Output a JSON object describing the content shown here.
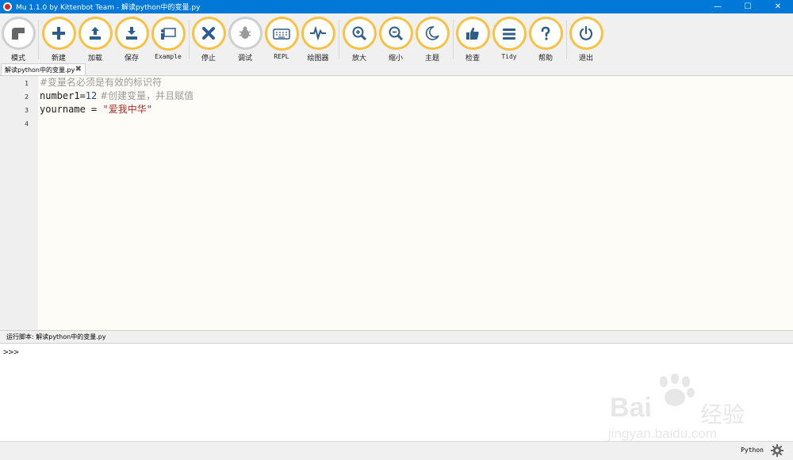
{
  "window": {
    "title": "Mu 1.1.0 by Kittenbot Team - 解读python中的变量.py",
    "minimize_glyph": "—",
    "maximize_glyph": "☐",
    "close_glyph": "✕"
  },
  "toolbar": {
    "accent_color": "#f7c244",
    "buttons": [
      {
        "label": "模式",
        "icon": "mode-icon"
      },
      {
        "label": "新建",
        "icon": "plus-icon"
      },
      {
        "label": "加载",
        "icon": "upload-icon"
      },
      {
        "label": "保存",
        "icon": "download-icon"
      },
      {
        "label": "Example",
        "icon": "presentation-icon"
      },
      {
        "label": "停止",
        "icon": "close-icon"
      },
      {
        "label": "调试",
        "icon": "bug-icon"
      },
      {
        "label": "REPL",
        "icon": "keyboard-icon"
      },
      {
        "label": "绘图器",
        "icon": "pulse-icon"
      },
      {
        "label": "放大",
        "icon": "zoom-in-icon"
      },
      {
        "label": "缩小",
        "icon": "zoom-out-icon"
      },
      {
        "label": "主题",
        "icon": "moon-icon"
      },
      {
        "label": "检查",
        "icon": "thumbs-up-icon"
      },
      {
        "label": "Tidy",
        "icon": "menu-lines-icon"
      },
      {
        "label": "帮助",
        "icon": "question-icon"
      },
      {
        "label": "退出",
        "icon": "power-icon"
      }
    ]
  },
  "tabs": [
    {
      "label": "解读python中的变量.py",
      "close_glyph": "✖"
    }
  ],
  "editor": {
    "line_numbers": [
      "1",
      "2",
      "3",
      "4"
    ],
    "lines": {
      "l1_comment": "#变量名必须是有效的标识符",
      "l2_code": "number1=",
      "l2_number": "12",
      "l2_comment": " #创建变量，并且赋值",
      "l3_code": "yourname = ",
      "l3_string": "\"爱我中华\""
    }
  },
  "run_panel": {
    "label": "运行脚本: 解读python中的变量.py",
    "prompt": ">>>"
  },
  "watermark": {
    "brand": "Bai",
    "brand_cn": "经验",
    "url": "jingyan.baidu.com"
  },
  "status": {
    "mode": "Python"
  }
}
